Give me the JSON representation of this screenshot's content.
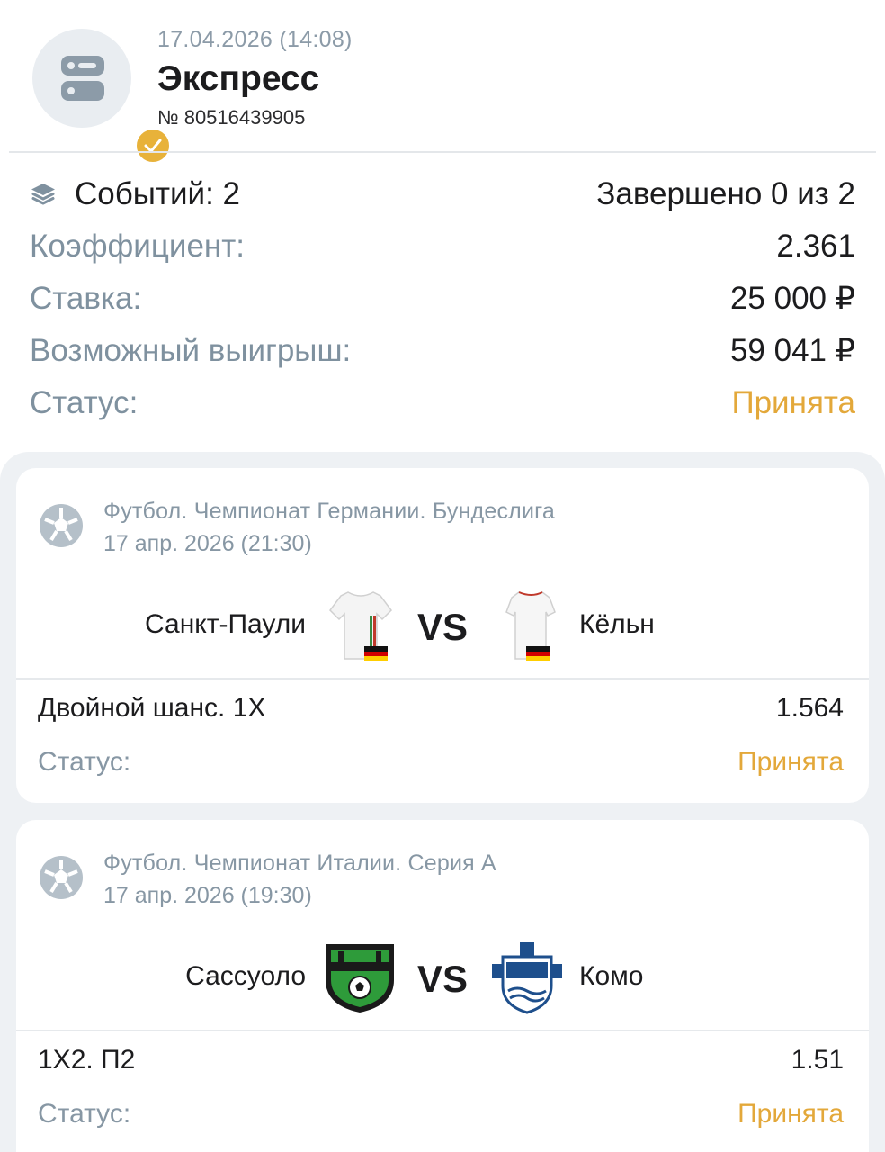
{
  "header": {
    "datetime": "17.04.2026 (14:08)",
    "title": "Экспресс",
    "number": "№ 80516439905",
    "icon": "bet-slip-icon",
    "badge_icon": "check-icon"
  },
  "summary": {
    "events_label": "Событий: 2",
    "completed": "Завершено 0 из 2",
    "coef_label": "Коэффициент:",
    "coef_value": "2.361",
    "stake_label": "Ставка:",
    "stake_value": "25 000 ₽",
    "win_label": "Возможный выигрыш:",
    "win_value": "59 041 ₽",
    "status_label": "Статус:",
    "status_value": "Принята"
  },
  "events": [
    {
      "league": "Футбол. Чемпионат Германии. Бундеслига",
      "date": "17 апр. 2026 (21:30)",
      "home": "Санкт-Паули",
      "vs": "VS",
      "away": "Кёльн",
      "market": "Двойной шанс. 1X",
      "odds": "1.564",
      "status_label": "Статус:",
      "status_value": "Принята"
    },
    {
      "league": "Футбол. Чемпионат Италии. Серия А",
      "date": "17 апр. 2026 (19:30)",
      "home": "Сассуоло",
      "vs": "VS",
      "away": "Комо",
      "market": "1X2. П2",
      "odds": "1.51",
      "status_label": "Статус:",
      "status_value": "Принята"
    }
  ],
  "colors": {
    "accent": "#e3a83a",
    "badge": "#e8b23a",
    "muted": "#7f919f",
    "card_bg": "#eef1f4"
  }
}
